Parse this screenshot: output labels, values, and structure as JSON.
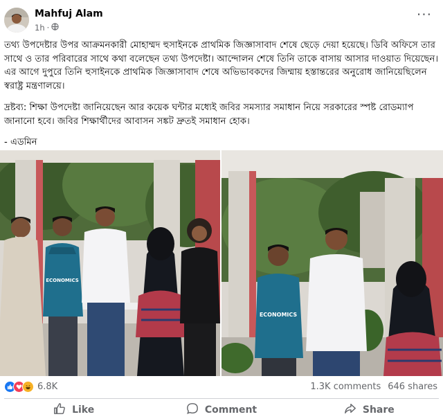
{
  "post": {
    "author": "Mahfuj Alam",
    "time": "1h",
    "paragraphs": [
      "তথ্য উপদেষ্টার উপর আক্রমনকারী মোহাম্মদ হুসাইনকে প্রাথমিক জিজ্ঞাসাবাদ শেষে ছেড়ে দেয়া হয়েছে। ডিবি অফিসে তার সাথে ও তার পরিবারের সাথে কথা বলেছেন তথ্য উপদেষ্টা। আন্দোলন শেষে তিনি তাকে বাসায় আসার দাওয়াত দিয়েছেন। এর আগে দুপুরে তিনি হুসাইনকে প্রাথমিক জিজ্ঞাসাবাদ শেষে অভিভাবকদের জিম্মায় হস্তান্তরের অনুরোধ জানিয়েছিলেন স্বরাষ্ট্র মন্ত্রণালয়ে।",
      "দ্রষ্টব্য: শিক্ষা উপদেষ্টা জানিয়েছেন আর কয়েক ঘন্টার মধ্যেই জবির সমস্যার সমাধান নিয়ে সরকারের স্পষ্ট রোডম্যাপ জানানো হবে। জবির শিক্ষার্থীদের আবাসন সঙ্কট দ্রুতই সমাধান হোক।"
    ],
    "signature": "- এডমিন",
    "jersey_text": "ECONOMICS"
  },
  "reactions": {
    "count": "6.8K",
    "types": [
      "like",
      "love",
      "haha"
    ],
    "colors": {
      "like": "#1877f2",
      "love": "#f33e58",
      "haha": "#f7b125"
    }
  },
  "stats": {
    "comments": "1.3K comments",
    "shares": "646 shares"
  },
  "actions": {
    "like": "Like",
    "comment": "Comment",
    "share": "Share"
  },
  "icons": [
    "globe-icon",
    "more-icon",
    "like-reaction-icon",
    "love-reaction-icon",
    "haha-reaction-icon",
    "thumbs-up-icon",
    "comment-icon",
    "share-icon"
  ]
}
